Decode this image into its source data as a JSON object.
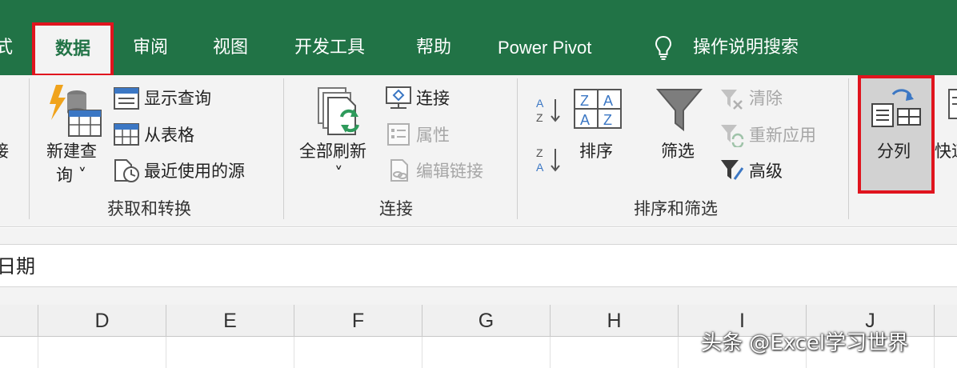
{
  "tabs": {
    "format_partial": "式",
    "data": "数据",
    "review": "审阅",
    "view": "视图",
    "developer": "开发工具",
    "help": "帮助",
    "power_pivot": "Power Pivot",
    "tell_me": "操作说明搜索"
  },
  "get_transform": {
    "left_partial": "接",
    "new_query_line1": "新建查",
    "new_query_line2": "询 ˅",
    "show_queries": "显示查询",
    "from_table": "从表格",
    "recent_sources": "最近使用的源",
    "group_label": "获取和转换"
  },
  "connections": {
    "refresh_all_line1": "全部刷新",
    "refresh_all_line2": "˅",
    "connections": "连接",
    "properties": "属性",
    "edit_links": "编辑链接",
    "group_label": "连接"
  },
  "sort_filter": {
    "sort": "排序",
    "filter": "筛选",
    "clear": "清除",
    "reapply": "重新应用",
    "advanced": "高级",
    "group_label": "排序和筛选"
  },
  "data_tools": {
    "text_to_columns": "分列",
    "flash_fill_partial": "快速"
  },
  "formula_bar": {
    "value": "日期"
  },
  "columns": [
    "D",
    "E",
    "F",
    "G",
    "H",
    "I",
    "J"
  ],
  "watermark": "头条 @Excel学习世界",
  "colors": {
    "accent_green": "#217346",
    "highlight_red": "#e0141e",
    "ribbon_bg": "#f3f3f3"
  }
}
